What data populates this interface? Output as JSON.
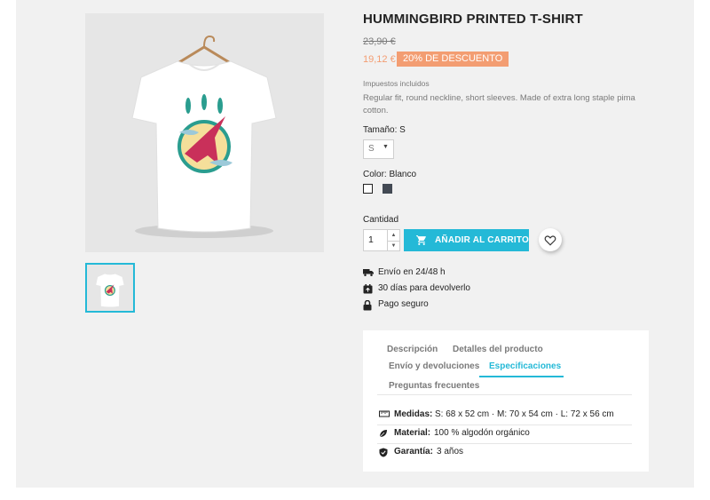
{
  "product": {
    "title": "HUMMINGBIRD PRINTED T-SHIRT",
    "old_price": "23,90 €",
    "price": "19,12 €",
    "discount": "20% DE DESCUENTO",
    "tax_note": "Impuestos incluidos",
    "description": "Regular fit, round neckline, short sleeves. Made of extra long staple pima cotton."
  },
  "size": {
    "label": "Tamaño: S",
    "selected": "S"
  },
  "color": {
    "label": "Color: Blanco",
    "swatches": [
      "#ffffff",
      "#434a54"
    ]
  },
  "quantity": {
    "label": "Cantidad",
    "value": "1"
  },
  "actions": {
    "add_to_cart": "AÑADIR AL CARRITO"
  },
  "reassurance": [
    {
      "icon": "truck-icon",
      "text": "Envío en 24/48 h"
    },
    {
      "icon": "calendar-return-icon",
      "text": "30 días para devolverlo"
    },
    {
      "icon": "lock-icon",
      "text": "Pago seguro"
    }
  ],
  "tabs": [
    "Descripción",
    "Detalles del producto",
    "Envío y devoluciones",
    "Especificaciones",
    "Preguntas frecuentes"
  ],
  "active_tab": "Especificaciones",
  "specs": [
    {
      "icon": "ruler-icon",
      "label": "Medidas:",
      "value": "S: 68 x 52 cm · M: 70 x 54 cm · L: 72 x 56 cm"
    },
    {
      "icon": "leaf-icon",
      "label": "Material:",
      "value": "100 % algodón orgánico"
    },
    {
      "icon": "shield-check-icon",
      "label": "Garantía:",
      "value": "3 años"
    }
  ],
  "colors": {
    "accent": "#24b9d7",
    "discount": "#f39d72"
  }
}
